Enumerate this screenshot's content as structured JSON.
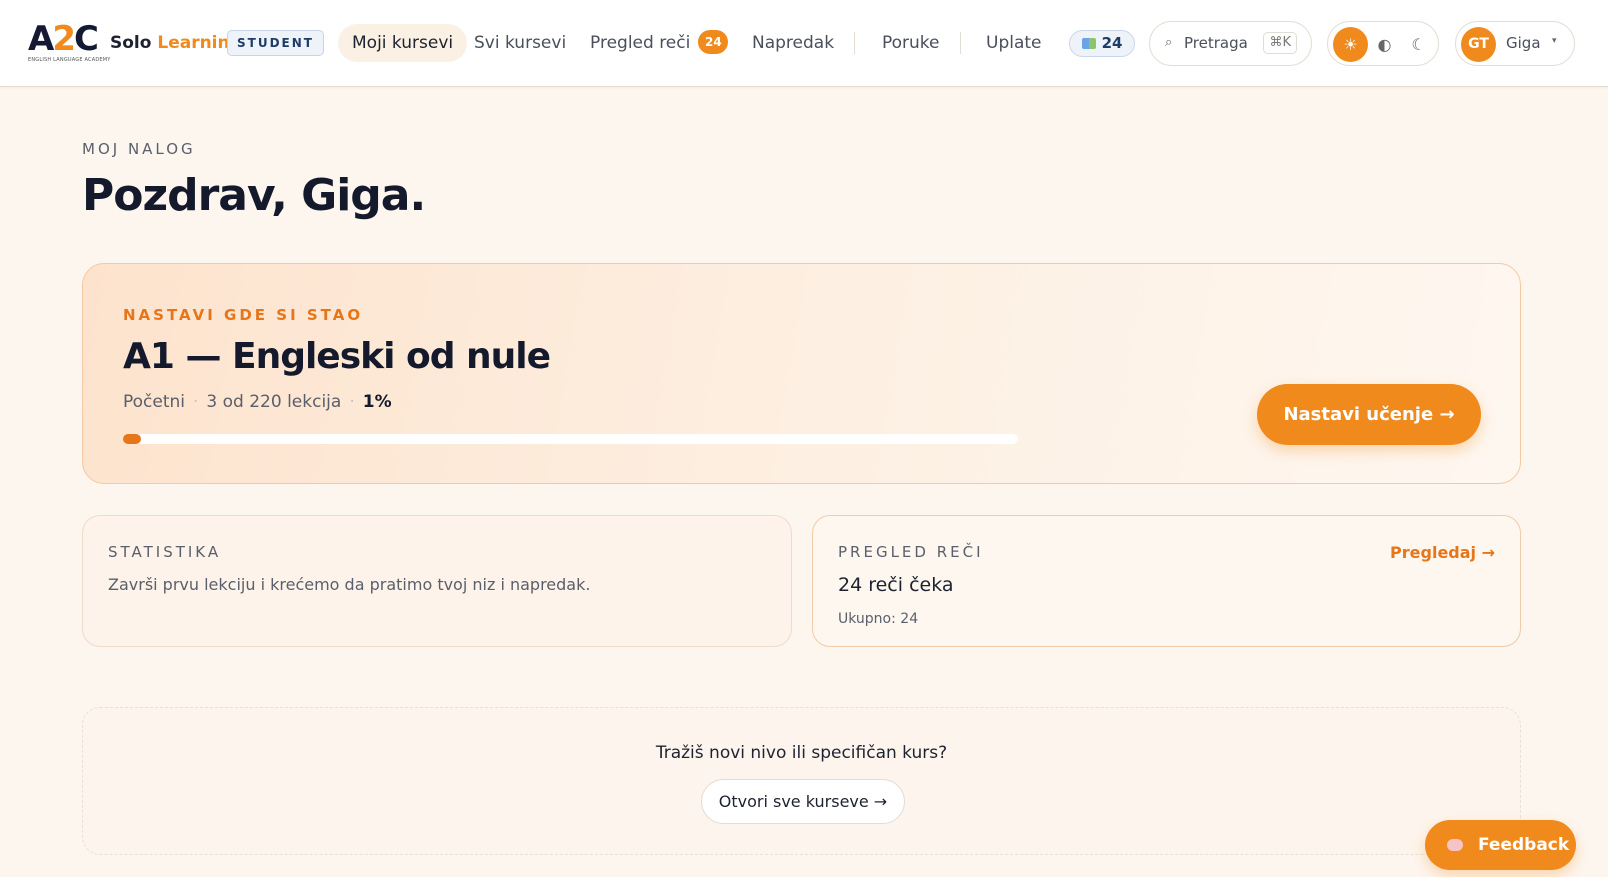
{
  "header": {
    "logo_text_left": "A",
    "logo_text_mid": "2",
    "logo_text_right": "C",
    "logo_subtitle": "ENGLISH LANGUAGE ACADEMY",
    "brand_solo": "Solo",
    "brand_learning": "Learning",
    "role_badge": "STUDENT",
    "nav": [
      {
        "label": "Moji kursevi",
        "active": true
      },
      {
        "label": "Svi kursevi"
      },
      {
        "label": "Pregled reči",
        "badge": "24"
      },
      {
        "label": "Napredak"
      },
      {
        "label": "Poruke"
      },
      {
        "label": "Uplate"
      }
    ],
    "streak_count": "24",
    "search_label": "Pretraga",
    "search_shortcut": "⌘K",
    "theme_icons": {
      "light": "☀",
      "system": "◐",
      "dark": "☾"
    },
    "user_initials": "GT",
    "user_name": "Giga",
    "user_caret": "▾"
  },
  "page": {
    "eyebrow": "MOJ NALOG",
    "title": "Pozdrav, Giga."
  },
  "continue_card": {
    "eyebrow": "NASTAVI GDE SI STAO",
    "course_title": "A1 — Engleski od nule",
    "level": "Početni",
    "lessons": "3 od 220 lekcija",
    "percent_label": "1%",
    "progress_fraction": 0.02,
    "button_label": "Nastavi učenje →"
  },
  "stats_card": {
    "eyebrow": "STATISTIKA",
    "text": "Završi prvu lekciju i krećemo da pratimo tvoj niz i napredak."
  },
  "review_card": {
    "eyebrow": "PREGLED REČI",
    "title": "24 reči čeka",
    "total": "Ukupno: 24",
    "link_label": "Pregledaj →"
  },
  "explore": {
    "question": "Tražiš novi nivo ili specifičan kurs?",
    "button_label": "Otvori sve kurseve →"
  },
  "feedback": {
    "label": "Feedback"
  },
  "colors": {
    "accent": "#f08a1c",
    "accent_dark": "#e5761a",
    "navy": "#1f3c66"
  }
}
